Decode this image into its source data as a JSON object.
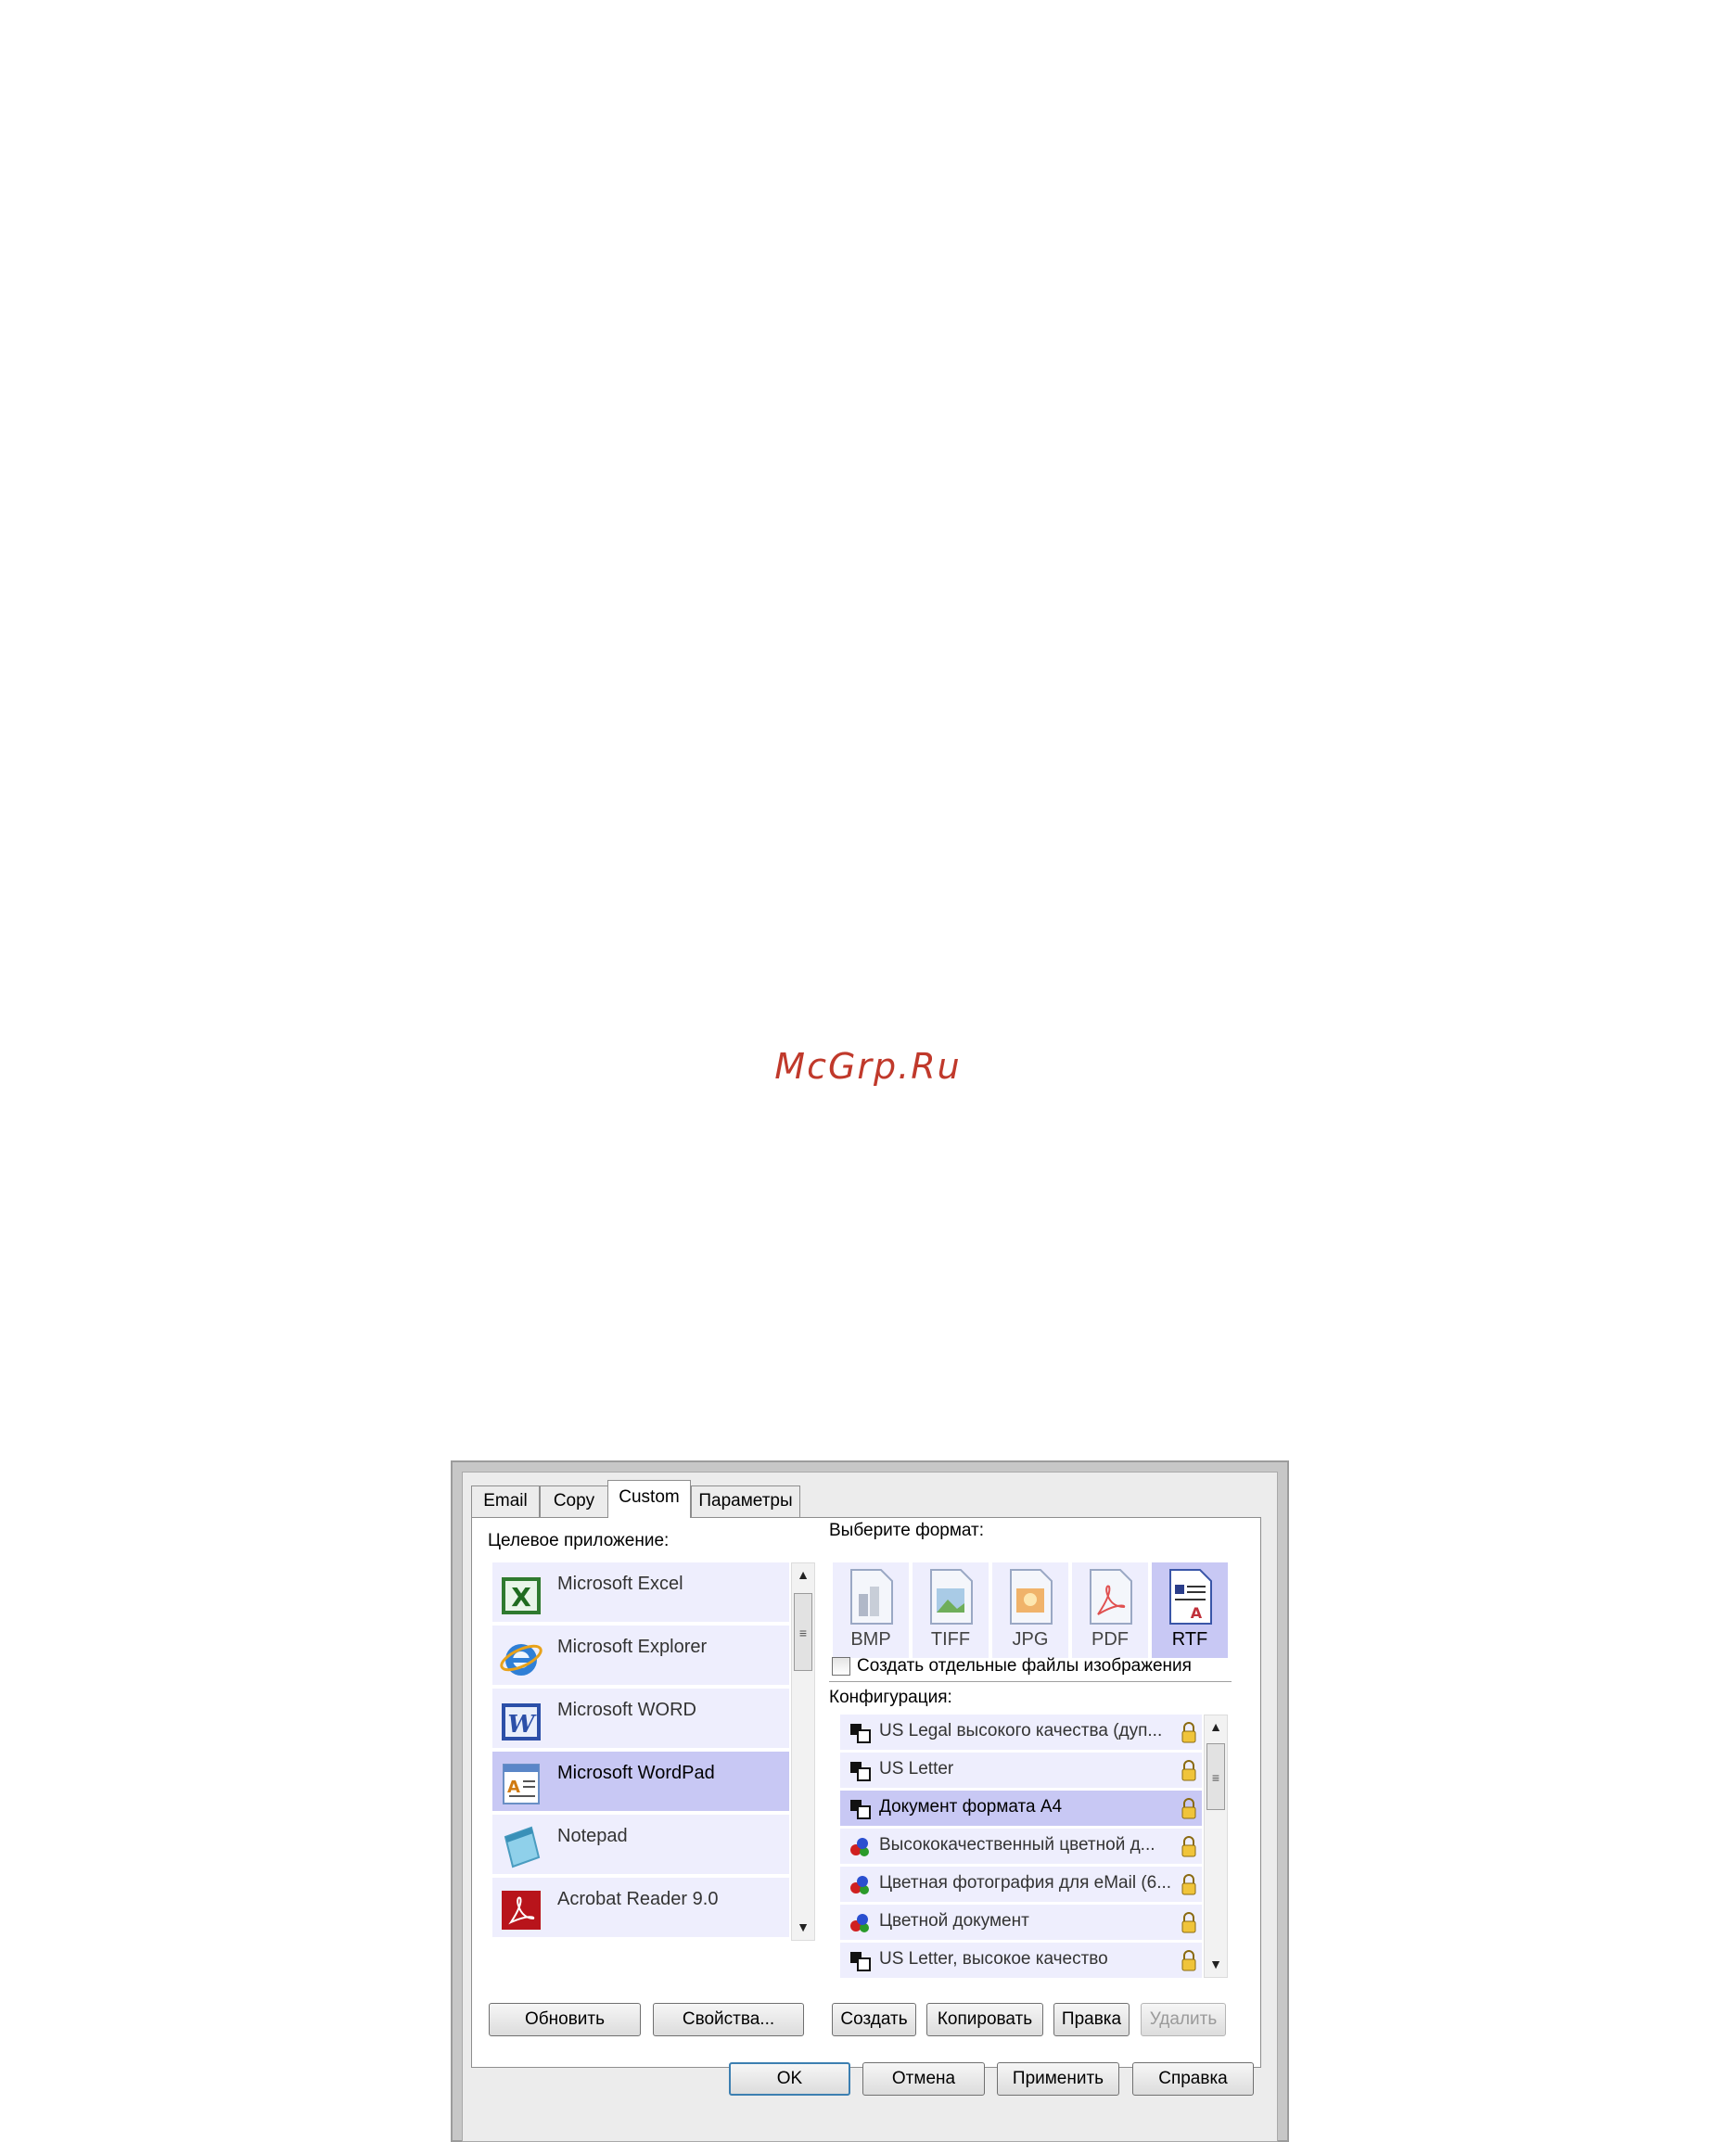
{
  "watermark": "McGrp.Ru",
  "tabs": [
    {
      "label": "Email"
    },
    {
      "label": "Copy"
    },
    {
      "label": "Custom",
      "active": true
    },
    {
      "label": "Параметры"
    }
  ],
  "left": {
    "label": "Целевое приложение:",
    "apps": [
      {
        "name": "Microsoft Excel",
        "icon": "excel-icon"
      },
      {
        "name": "Microsoft Explorer",
        "icon": "internet-explorer-icon"
      },
      {
        "name": "Microsoft WORD",
        "icon": "word-icon"
      },
      {
        "name": "Microsoft WordPad",
        "icon": "wordpad-icon",
        "selected": true
      },
      {
        "name": "Notepad",
        "icon": "notepad-icon"
      },
      {
        "name": "Acrobat Reader 9.0",
        "icon": "acrobat-icon"
      }
    ],
    "buttons": {
      "refresh": "Обновить",
      "properties": "Свойства..."
    }
  },
  "right": {
    "format_label": "Выберите формат:",
    "formats": [
      {
        "name": "BMP"
      },
      {
        "name": "TIFF"
      },
      {
        "name": "JPG"
      },
      {
        "name": "PDF"
      },
      {
        "name": "RTF",
        "selected": true
      }
    ],
    "separate_files_label": "Создать отдельные файлы изображения",
    "config_label": "Конфигурация:",
    "configs": [
      {
        "text": "US Legal высокого качества (дуп...",
        "icon": "bw-doc-icon"
      },
      {
        "text": "US Letter",
        "icon": "bw-doc-icon"
      },
      {
        "text": "Документ формата A4",
        "icon": "bw-doc-icon",
        "selected": true
      },
      {
        "text": "Высококачественный цветной д...",
        "icon": "color-doc-icon"
      },
      {
        "text": "Цветная фотография для eMail (6...",
        "icon": "color-doc-icon"
      },
      {
        "text": "Цветной документ",
        "icon": "color-doc-icon"
      },
      {
        "text": "US Letter, высокое качество",
        "icon": "bw-doc-icon"
      }
    ],
    "buttons": {
      "create": "Создать",
      "copy": "Копировать",
      "edit": "Правка",
      "delete": "Удалить"
    }
  },
  "footer": {
    "ok": "OK",
    "cancel": "Отмена",
    "apply": "Применить",
    "help": "Справка"
  },
  "colors": {
    "selection": "#c8c8f4",
    "item_bg": "#eeeefd",
    "default_button_border": "#3c7fb1"
  }
}
